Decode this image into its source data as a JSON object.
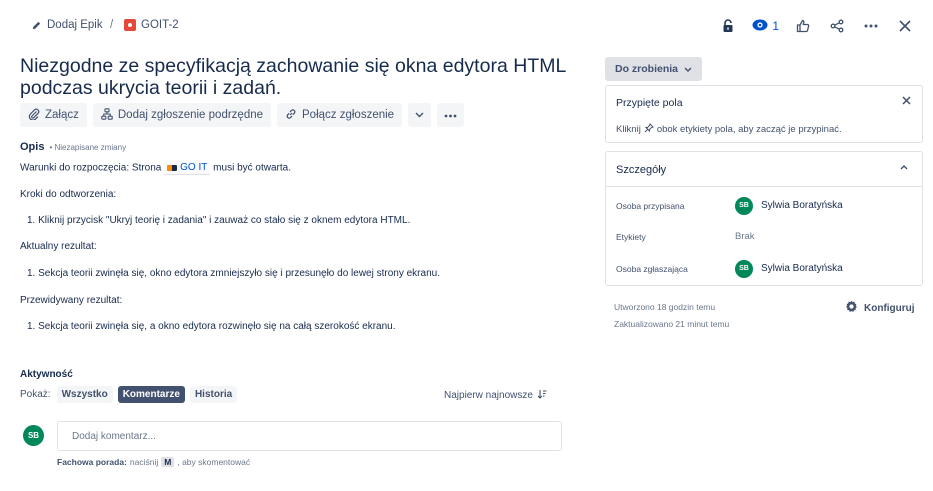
{
  "breadcrumb": {
    "epic_label": "Dodaj Epik",
    "separator": "/",
    "issue_key": "GOIT-2"
  },
  "top_actions": {
    "watch_count": "1",
    "icons": [
      "unlock-icon",
      "eye-icon",
      "thumbs-up-icon",
      "share-icon",
      "more-icon",
      "close-icon"
    ]
  },
  "issue": {
    "title": "Niezgodne ze specyfikacją zachowanie się okna edytora HTML podczas ukrycia teorii i zadań."
  },
  "toolbar": {
    "attach": "Załącz",
    "add_child": "Dodaj zgłoszenie podrzędne",
    "link_issue": "Połącz zgłoszenie"
  },
  "description": {
    "label": "Opis",
    "unsaved": "• Niezapisane zmiany",
    "precondition_before": "Warunki do rozpoczęcia: Strona",
    "precondition_link": "GO IT",
    "precondition_after": "musi być otwarta.",
    "steps_heading": "Kroki do odtworzenia:",
    "step_1": "1. Kliknij przycisk \"Ukryj teorię i zadania\" i zauważ co stało się z oknem edytora HTML.",
    "actual_heading": "Aktualny rezultat:",
    "actual_1": "1. Sekcja teorii zwinęła się, okno edytora zmniejszyło się i przesunęło do lewej strony ekranu.",
    "expected_heading": "Przewidywany rezultat:",
    "expected_1": "1. Sekcja teorii zwinęła się, a okno edytora rozwinęło się na całą szerokość ekranu."
  },
  "activity": {
    "label": "Aktywność",
    "show_label": "Pokaż:",
    "filters": [
      "Wszystko",
      "Komentarze",
      "Historia"
    ],
    "active_filter": "Komentarze",
    "sort_label": "Najpierw najnowsze",
    "comment_avatar": "SB",
    "comment_placeholder": "Dodaj komentarz...",
    "tip_bold": "Fachowa porada:",
    "tip_press": "naciśnij",
    "tip_key": "M",
    "tip_rest": ", aby skomentować"
  },
  "sidebar": {
    "status": "Do zrobienia",
    "pinned": {
      "title": "Przypięte pola",
      "text_before": "Kliknij",
      "text_after": "obok etykiety pola, aby zacząć je przypinać."
    },
    "details": {
      "title": "Szczegóły",
      "assignee_label": "Osoba przypisana",
      "assignee_initials": "SB",
      "assignee_name": "Sylwia Boratyńska",
      "labels_label": "Etykiety",
      "labels_value": "Brak",
      "reporter_label": "Osoba zgłaszająca",
      "reporter_initials": "SB",
      "reporter_name": "Sylwia Boratyńska"
    },
    "created": "Utworzono 18 godzin temu",
    "updated": "Zaktualizowano 21 minut temu",
    "configure": "Konfiguruj"
  },
  "colors": {
    "avatar_bg": "#00875a",
    "bug_icon": "#e5493a",
    "link_blue": "#0052cc",
    "active_filter_bg": "#42526e"
  }
}
